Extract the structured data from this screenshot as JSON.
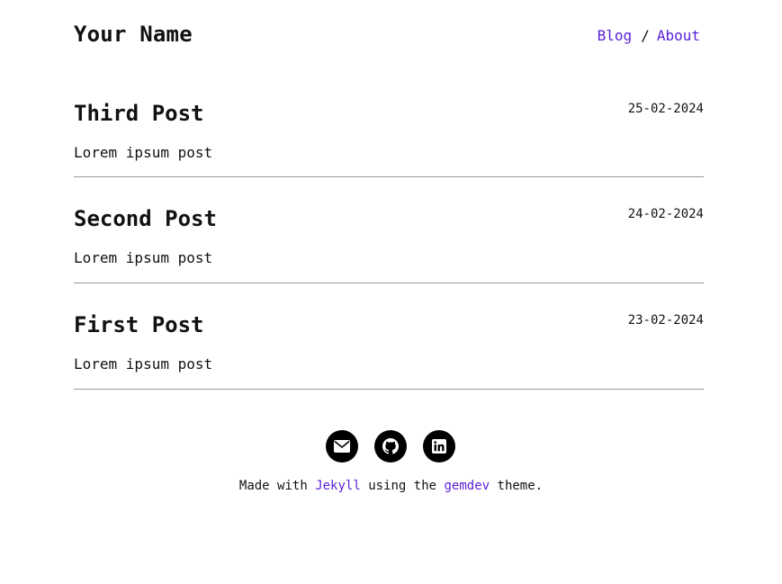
{
  "header": {
    "site_title": "Your Name",
    "nav": {
      "blog": "Blog",
      "separator": "/",
      "about": "About"
    }
  },
  "posts": [
    {
      "title": "Third Post",
      "date": "25-02-2024",
      "excerpt": "Lorem ipsum post"
    },
    {
      "title": "Second Post",
      "date": "24-02-2024",
      "excerpt": "Lorem ipsum post"
    },
    {
      "title": "First Post",
      "date": "23-02-2024",
      "excerpt": "Lorem ipsum post"
    }
  ],
  "footer": {
    "social_icons": [
      "envelope-icon",
      "github-icon",
      "linkedin-icon"
    ],
    "credits": {
      "made_with": "Made with",
      "jekyll": "Jekyll",
      "using_the": "using the",
      "gemdev": "gemdev",
      "theme": "theme."
    }
  },
  "colors": {
    "link": "#5b21d6",
    "text": "#111111",
    "divider": "#999999",
    "icon_bg": "#000000"
  }
}
